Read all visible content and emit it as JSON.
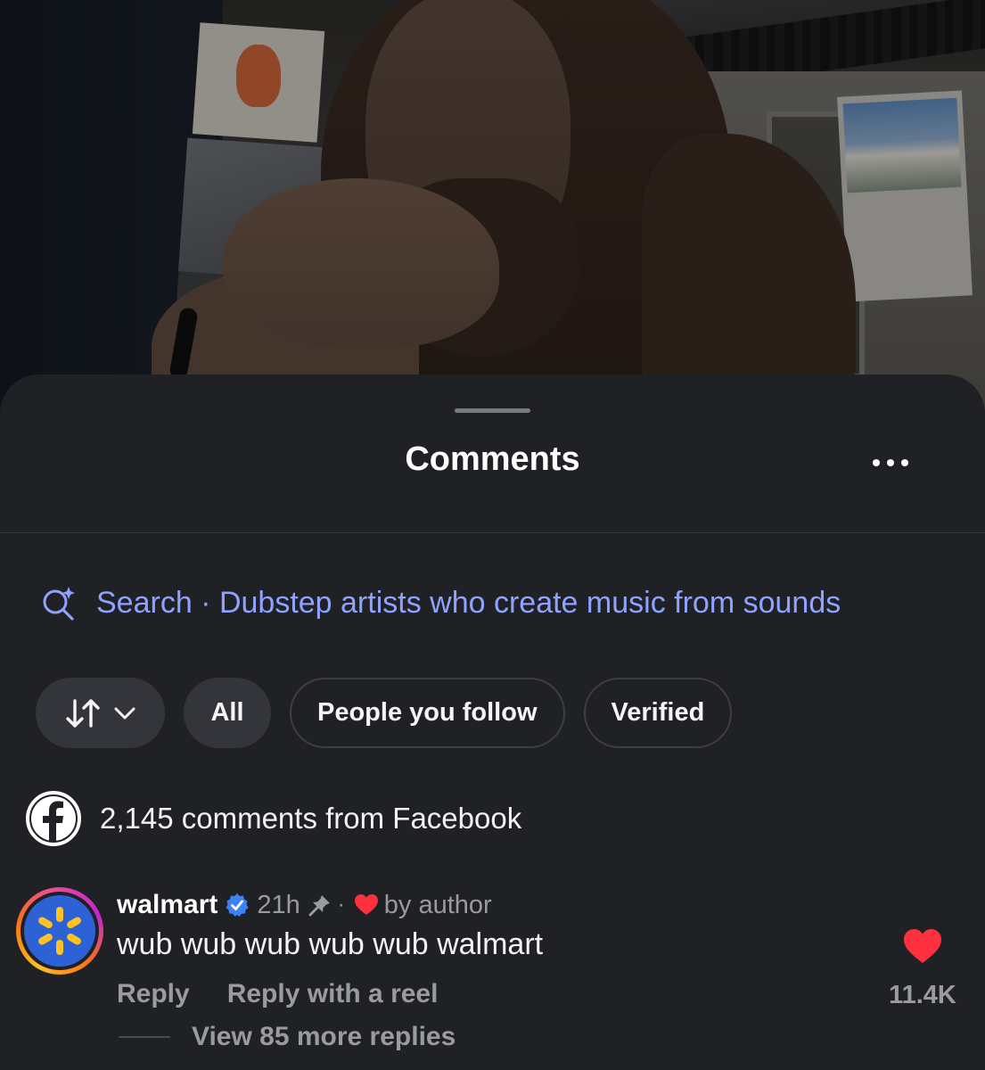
{
  "sheet": {
    "title": "Comments",
    "more_icon": "more-horizontal-icon"
  },
  "search": {
    "icon": "ai-search-sparkle-icon",
    "label": "Search · Dubstep artists who create music from sounds"
  },
  "filters": {
    "sort_icon": "sort-arrows-icon",
    "chevron_icon": "chevron-down-icon",
    "chips": [
      "All",
      "People you follow",
      "Verified"
    ]
  },
  "facebook": {
    "icon": "facebook-icon",
    "text": "2,145 comments from Facebook"
  },
  "comment": {
    "username": "walmart",
    "verified_icon": "verified-badge-icon",
    "time": "21h",
    "pin_icon": "pin-icon",
    "separator": "·",
    "author_like_icon": "heart-icon",
    "author_like_text": "by author",
    "body": "wub wub wub wub wub walmart",
    "reply_label": "Reply",
    "reply_reel_label": "Reply with a reel",
    "like_icon": "heart-filled-icon",
    "like_count": "11.4K",
    "view_replies": "View 85 more replies"
  },
  "colors": {
    "sheet_bg": "#202125",
    "link_blue": "#8fa2ff",
    "like_red": "#ff3040",
    "muted_text": "#9a9ba1",
    "walmart_blue": "#2d62d6",
    "walmart_yellow": "#ffc220"
  }
}
